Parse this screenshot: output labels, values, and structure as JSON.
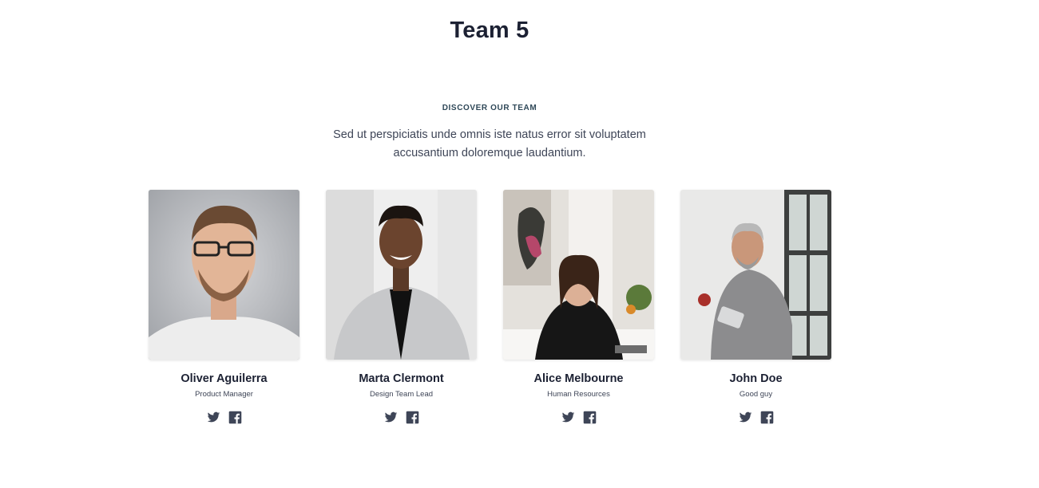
{
  "page": {
    "title": "Team 5"
  },
  "section": {
    "eyebrow": "DISCOVER OUR TEAM",
    "intro_line1": "Sed ut perspiciatis unde omnis iste natus error sit voluptatem",
    "intro_line2": "accusantium doloremque laudantium."
  },
  "team": [
    {
      "name": "Oliver Aguilerra",
      "role": "Product Manager"
    },
    {
      "name": "Marta Clermont",
      "role": "Design Team Lead"
    },
    {
      "name": "Alice Melbourne",
      "role": "Human Resources"
    },
    {
      "name": "John Doe",
      "role": "Good guy"
    }
  ],
  "icons": {
    "twitter": "twitter-icon",
    "facebook": "facebook-icon"
  },
  "colors": {
    "heading": "#1c2133",
    "body_text": "#3e4557",
    "eyebrow": "#2f4858",
    "icon": "#3e4557",
    "background": "#ffffff"
  }
}
